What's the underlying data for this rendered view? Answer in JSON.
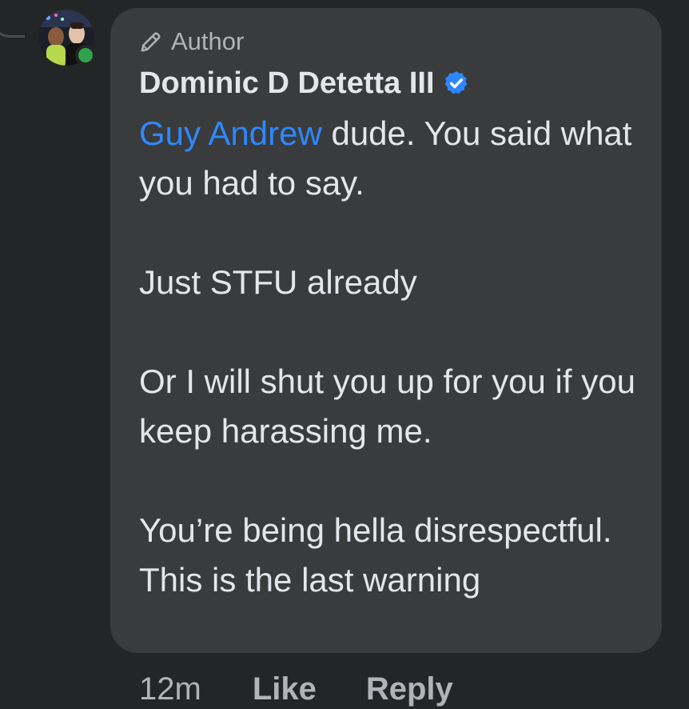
{
  "comment": {
    "author_badge_label": "Author",
    "author_badge_icon": "pencil-icon",
    "author_name": "Dominic D Detetta III",
    "verified_icon": "verified-badge-icon",
    "avatar_online": true,
    "mention": "Guy Andrew",
    "paragraphs": {
      "p1_after_mention": " dude. You said what you had to say.",
      "p2": "Just STFU already",
      "p3": "Or I will shut you up for you if you keep harassing me.",
      "p4": "You’re being hella disrespectful. This is the last warning"
    },
    "timestamp": "12m",
    "like_label": "Like",
    "reply_label": "Reply"
  },
  "colors": {
    "background": "#242526",
    "bubble": "#3a3b3c",
    "primary_text": "#e4e6eb",
    "secondary_text": "#b0b3b8",
    "mention": "#2d88ff",
    "verified": "#2d88ff",
    "online": "#31a24c"
  }
}
